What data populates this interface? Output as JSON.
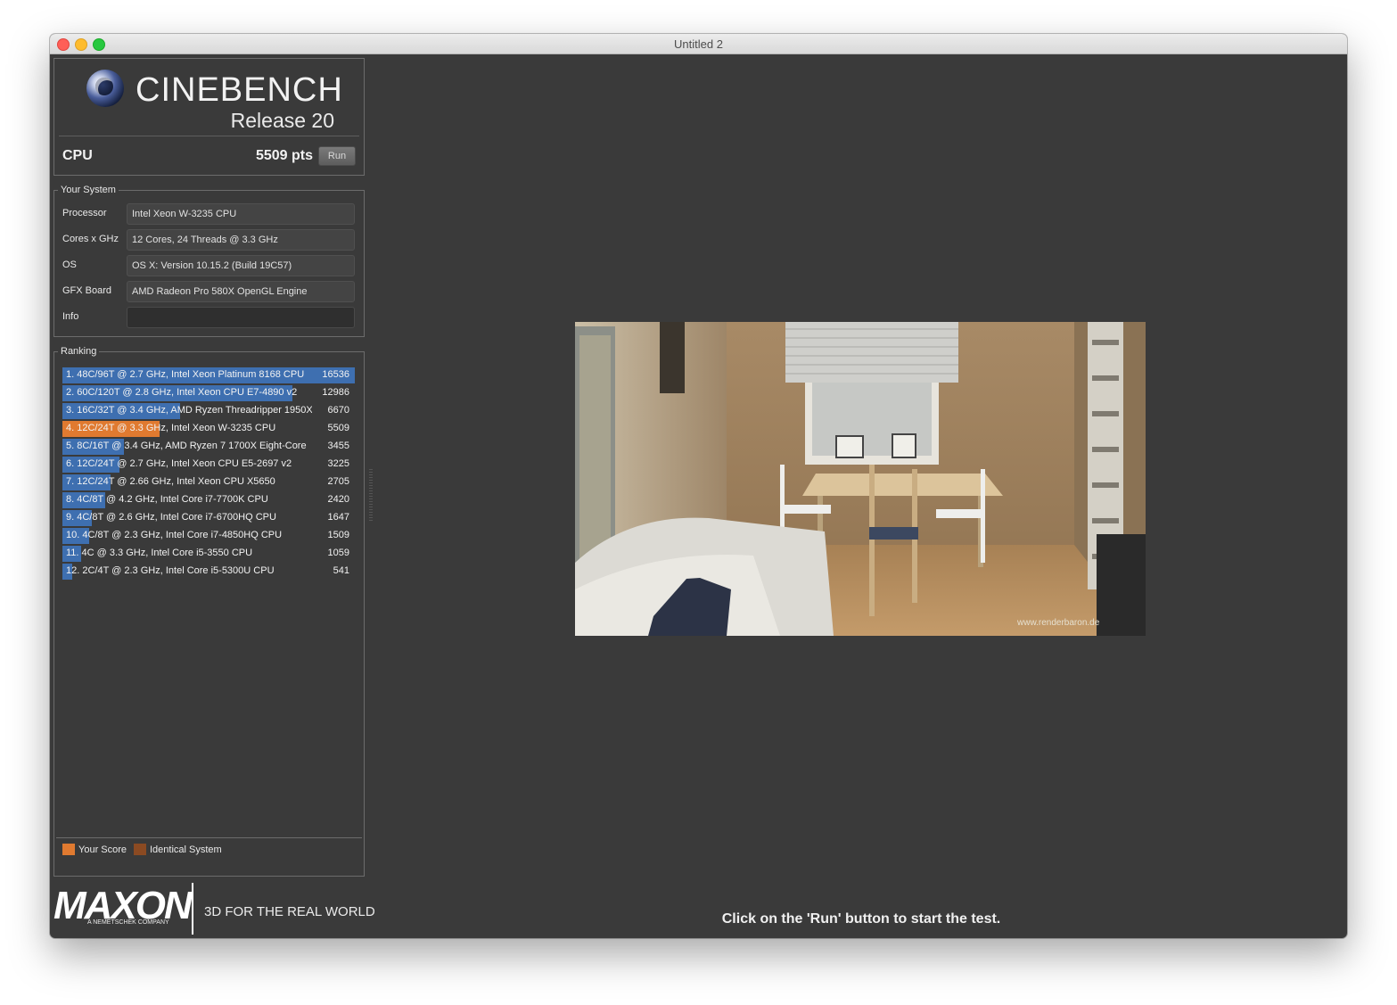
{
  "window": {
    "title": "Untitled 2"
  },
  "header": {
    "logo_title": "CINEBENCH",
    "logo_release": "Release 20",
    "cpu_label": "CPU",
    "cpu_score": "5509 pts",
    "run_label": "Run"
  },
  "system": {
    "legend": "Your System",
    "rows": [
      {
        "label": "Processor",
        "value": "Intel Xeon W-3235 CPU"
      },
      {
        "label": "Cores x GHz",
        "value": "12 Cores, 24 Threads @ 3.3 GHz"
      },
      {
        "label": "OS",
        "value": "OS X: Version 10.15.2 (Build 19C57)"
      },
      {
        "label": "GFX Board",
        "value": "AMD Radeon Pro 580X OpenGL Engine"
      },
      {
        "label": "Info",
        "value": ""
      }
    ]
  },
  "ranking": {
    "legend": "Ranking",
    "max_score": 16536,
    "colors": {
      "blue": "#3e6fb0",
      "orange": "#e07a30"
    },
    "items": [
      {
        "text": "1. 48C/96T @ 2.7 GHz, Intel Xeon Platinum 8168 CPU",
        "score": "16536",
        "value": 16536,
        "mine": false
      },
      {
        "text": "2. 60C/120T @ 2.8 GHz, Intel Xeon CPU E7-4890 v2",
        "score": "12986",
        "value": 12986,
        "mine": false
      },
      {
        "text": "3. 16C/32T @ 3.4 GHz, AMD Ryzen Threadripper 1950X",
        "score": "6670",
        "value": 6670,
        "mine": false
      },
      {
        "text": "4. 12C/24T @ 3.3 GHz, Intel Xeon W-3235 CPU",
        "score": "5509",
        "value": 5509,
        "mine": true
      },
      {
        "text": "5. 8C/16T @ 3.4 GHz, AMD Ryzen 7 1700X Eight-Core",
        "score": "3455",
        "value": 3455,
        "mine": false
      },
      {
        "text": "6. 12C/24T @ 2.7 GHz, Intel Xeon CPU E5-2697 v2",
        "score": "3225",
        "value": 3225,
        "mine": false
      },
      {
        "text": "7. 12C/24T @ 2.66 GHz, Intel Xeon CPU X5650",
        "score": "2705",
        "value": 2705,
        "mine": false
      },
      {
        "text": "8. 4C/8T @ 4.2 GHz, Intel Core i7-7700K CPU",
        "score": "2420",
        "value": 2420,
        "mine": false
      },
      {
        "text": "9. 4C/8T @ 2.6 GHz, Intel Core i7-6700HQ CPU",
        "score": "1647",
        "value": 1647,
        "mine": false
      },
      {
        "text": "10. 4C/8T @ 2.3 GHz, Intel Core i7-4850HQ CPU",
        "score": "1509",
        "value": 1509,
        "mine": false
      },
      {
        "text": "11. 4C @ 3.3 GHz, Intel Core i5-3550 CPU",
        "score": "1059",
        "value": 1059,
        "mine": false
      },
      {
        "text": "12. 2C/4T @ 2.3 GHz, Intel Core i5-5300U CPU",
        "score": "541",
        "value": 541,
        "mine": false
      }
    ],
    "legend_your_score": "Your Score",
    "legend_identical": "Identical System",
    "legend_colors": {
      "your_score": "#e07a30",
      "identical": "#8b4a22"
    }
  },
  "footer": {
    "maxon": "MAXON",
    "maxon_sub": "A NEMETSCHEK COMPANY",
    "tagline": "3D FOR THE REAL WORLD"
  },
  "render": {
    "watermark": "www.renderbaron.de"
  },
  "status": {
    "message": "Click on the 'Run' button to start the test."
  }
}
